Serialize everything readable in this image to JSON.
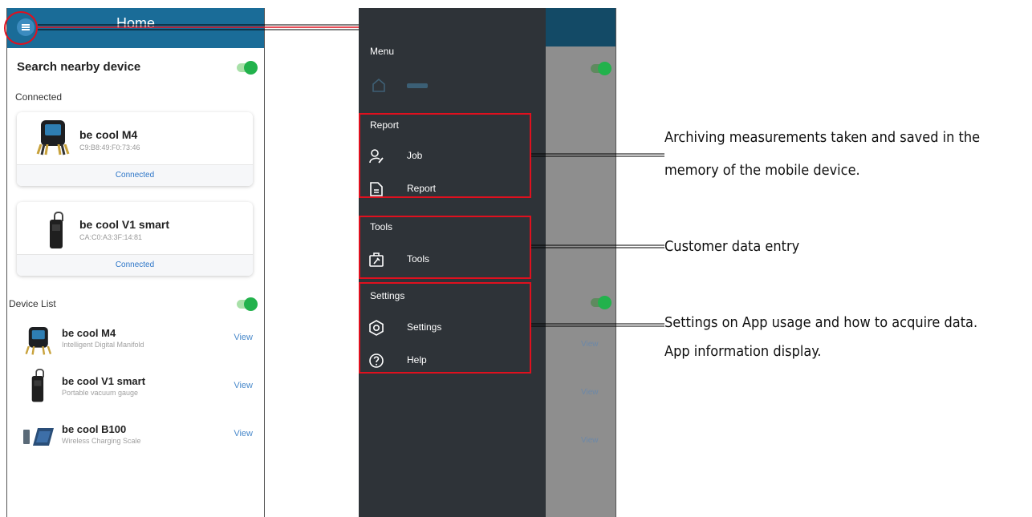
{
  "home": {
    "title": "Home",
    "search_label": "Search nearby device",
    "connected_label": "Connected",
    "device_list_label": "Device List",
    "connected_cards": [
      {
        "name": "be cool M4",
        "mac": "C9:B8:49:F0:73:46",
        "status": "Connected"
      },
      {
        "name": "be cool V1 smart",
        "mac": "CA:C0:A3:3F:14:81",
        "status": "Connected"
      }
    ],
    "device_list": [
      {
        "name": "be cool M4",
        "subtitle": "Intelligent Digital Manifold",
        "action": "View"
      },
      {
        "name": "be cool V1 smart",
        "subtitle": "Portable vacuum gauge",
        "action": "View"
      },
      {
        "name": "be cool B100",
        "subtitle": "Wireless Charging Scale",
        "action": "View"
      }
    ]
  },
  "drawer": {
    "menu_header": "Menu",
    "report_header": "Report",
    "job_label": "Job",
    "report_label": "Report",
    "tools_header": "Tools",
    "tools_label": "Tools",
    "settings_header": "Settings",
    "settings_label": "Settings",
    "help_label": "Help",
    "background_views": [
      "View",
      "View",
      "View"
    ]
  },
  "annotations": {
    "report_line1": "Archiving measurements taken and saved in the",
    "report_line2": "memory of the mobile device.",
    "tools": "Customer data entry",
    "settings_line1": "Settings on App usage and how to acquire data.",
    "settings_line2": "App information display."
  },
  "colors": {
    "header_blue": "#1a6c98",
    "drawer_bg": "#2e3338",
    "highlight_red": "#e0101e",
    "toggle_green": "#22b24c",
    "link_blue": "#2d76c8"
  }
}
